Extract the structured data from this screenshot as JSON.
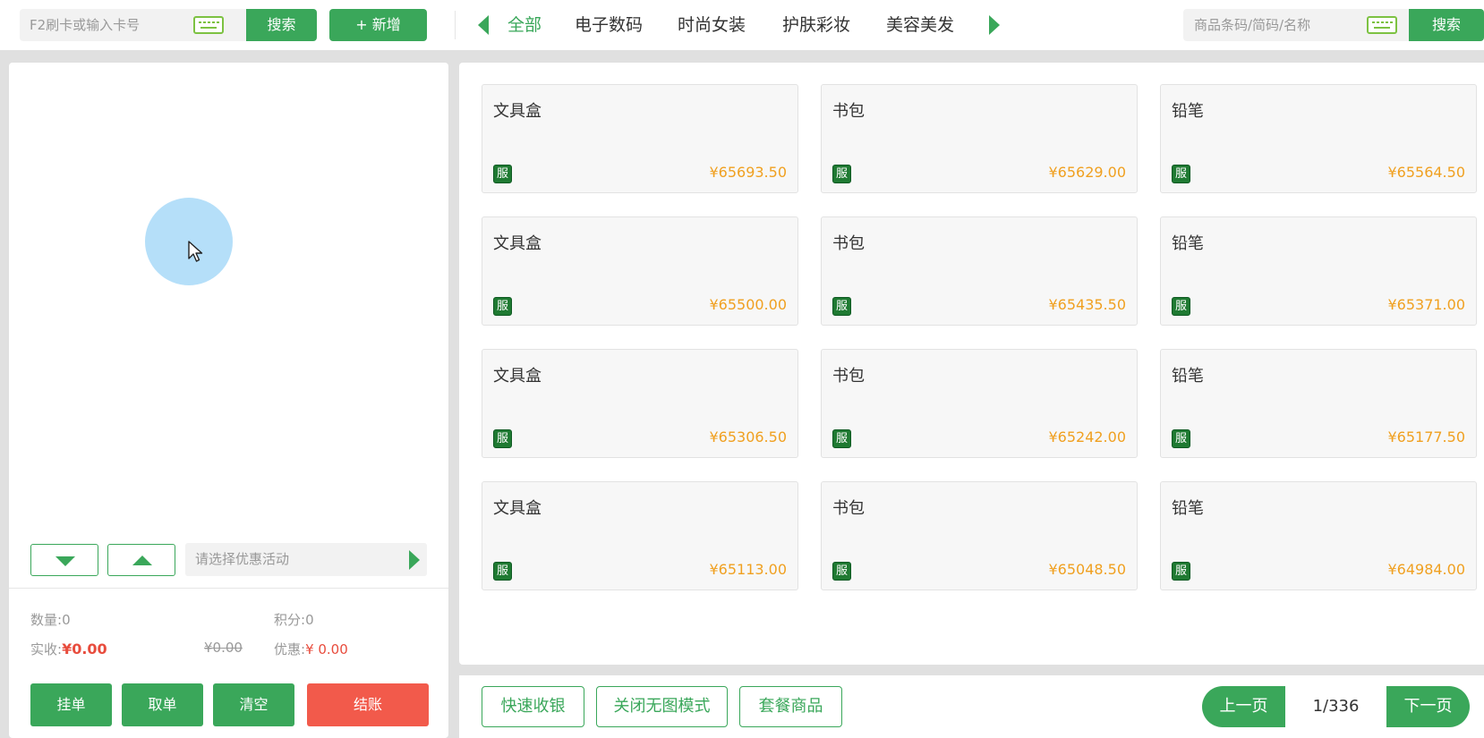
{
  "topbar": {
    "card_placeholder": "F2刷卡或输入卡号",
    "card_search_label": "搜索",
    "add_label": "+ 新增",
    "categories": [
      "全部",
      "电子数码",
      "时尚女装",
      "护肤彩妆",
      "美容美发"
    ],
    "active_category": "全部",
    "goods_placeholder": "商品条码/简码/名称",
    "goods_search_label": "搜索"
  },
  "order": {
    "promo_placeholder": "请选择优惠活动",
    "quantity_label": "数量:",
    "quantity_value": "0",
    "points_label": "积分:",
    "points_value": "0",
    "received_label": "实收:",
    "received_value": "¥0.00",
    "original_value": "¥0.00",
    "discount_label": "优惠:",
    "discount_value": "¥ 0.00",
    "buttons": {
      "hold": "挂单",
      "retrieve": "取单",
      "clear": "清空",
      "checkout": "结账"
    }
  },
  "products": [
    {
      "name": "文具盒",
      "tag": "服",
      "price": "¥65693.50"
    },
    {
      "name": "书包",
      "tag": "服",
      "price": "¥65629.00"
    },
    {
      "name": "铅笔",
      "tag": "服",
      "price": "¥65564.50"
    },
    {
      "name": "文具盒",
      "tag": "服",
      "price": "¥65500.00"
    },
    {
      "name": "书包",
      "tag": "服",
      "price": "¥65435.50"
    },
    {
      "name": "铅笔",
      "tag": "服",
      "price": "¥65371.00"
    },
    {
      "name": "文具盒",
      "tag": "服",
      "price": "¥65306.50"
    },
    {
      "name": "书包",
      "tag": "服",
      "price": "¥65242.00"
    },
    {
      "name": "铅笔",
      "tag": "服",
      "price": "¥65177.50"
    },
    {
      "name": "文具盒",
      "tag": "服",
      "price": "¥65113.00"
    },
    {
      "name": "书包",
      "tag": "服",
      "price": "¥65048.50"
    },
    {
      "name": "铅笔",
      "tag": "服",
      "price": "¥64984.00"
    }
  ],
  "footer": {
    "quick_checkout": "快速收银",
    "no_image_mode": "关闭无图模式",
    "combo_goods": "套餐商品",
    "prev_page": "上一页",
    "page_indicator": "1/336",
    "next_page": "下一页"
  },
  "colors": {
    "accent": "#3aa75a",
    "price": "#f0a020",
    "danger": "#f25a4b"
  }
}
